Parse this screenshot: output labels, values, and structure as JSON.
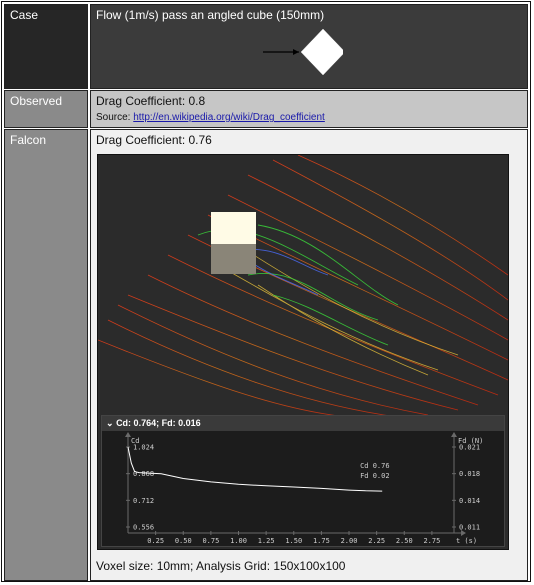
{
  "rows": {
    "case": {
      "label": "Case",
      "title": "Flow (1m/s) pass an angled cube (150mm)"
    },
    "observed": {
      "label": "Observed",
      "drag_text": "Drag Coefficient: 0.8",
      "source_label": "Source:",
      "source_link": "http://en.wikipedia.org/wiki/Drag_coefficient"
    },
    "falcon": {
      "label": "Falcon",
      "drag_text": "Drag Coefficient: 0.76",
      "panel_title": "Cd: 0.764; Fd: 0.016",
      "footer": "Voxel size: 10mm; Analysis Grid: 150x100x100"
    }
  },
  "chart_data": {
    "type": "line",
    "title": "Cd: 0.764; Fd: 0.016",
    "x_ticks": [
      "0.25",
      "0.50",
      "0.75",
      "1.00",
      "1.25",
      "1.50",
      "1.75",
      "2.00",
      "2.25",
      "2.50",
      "2.75"
    ],
    "x_unit": "t (s)",
    "ylabel_left": "Cd",
    "ylabel_right": "Fd (N)",
    "y_ticks_left": [
      "1.024",
      "0.868",
      "0.712",
      "0.556"
    ],
    "y_ticks_right": [
      "0.021",
      "0.018",
      "0.014",
      "0.011"
    ],
    "ylim_left": [
      0.556,
      1.024
    ],
    "xlim": [
      0.0,
      2.95
    ],
    "series": [
      {
        "x": [
          0.0,
          0.03,
          0.06,
          0.1,
          0.3,
          0.5,
          0.75,
          1.0,
          1.25,
          1.5,
          1.75,
          2.0,
          2.15,
          2.3
        ],
        "y": [
          1.024,
          0.93,
          0.88,
          0.874,
          0.867,
          0.84,
          0.82,
          0.806,
          0.797,
          0.79,
          0.782,
          0.772,
          0.768,
          0.766
        ]
      }
    ],
    "annotations": [
      "Cd  0.76",
      "Fd  0.02"
    ],
    "colors": {
      "line": "#ffffff",
      "background": "#1c1c1c",
      "grid": "#6a6a6a"
    }
  }
}
